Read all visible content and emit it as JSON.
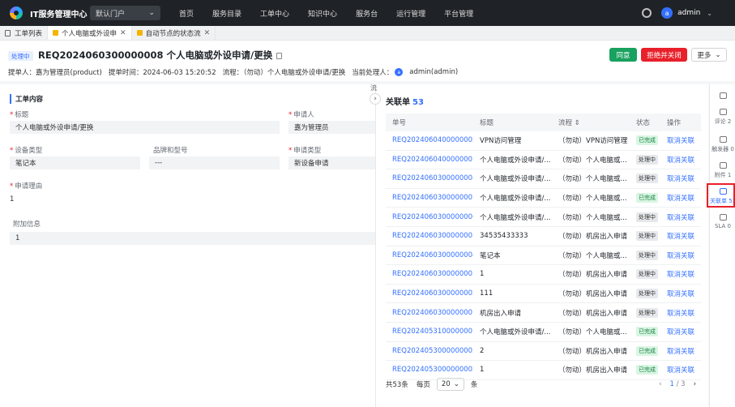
{
  "nav": {
    "brand": "IT服务管理中心",
    "portal": "默认门户",
    "menu": [
      "首页",
      "服务目录",
      "工单中心",
      "知识中心",
      "服务台",
      "运行管理",
      "平台管理"
    ],
    "user_initial": "a",
    "user": "admin"
  },
  "tabs": [
    {
      "label": "工单列表"
    },
    {
      "label": "个人电脑或外设申"
    },
    {
      "label": "自动节点的状态流"
    }
  ],
  "header": {
    "status": "处理中",
    "title": "REQ2024060300000008 个人电脑或外设申请/更换",
    "submitter": "提单人：嘉为管理员(product)",
    "submit_time": "提单时间：2024-06-03 15:20:52",
    "flow": "流程：（勿动）个人电脑或外设申请/更换",
    "handler_label": "当前处理人：",
    "handler": "admin(admin)",
    "approve": "同意",
    "reject": "拒绝并关闭",
    "more": "更多"
  },
  "form": {
    "section": "工单内容",
    "title_label": "标题",
    "title_value": "个人电脑或外设申请/更换",
    "applicant_label": "申请人",
    "applicant_value": "嘉为管理员",
    "device_type_label": "设备类型",
    "device_type_value": "笔记本",
    "brand_label": "品牌和型号",
    "brand_value": "---",
    "apply_type_label": "申请类型",
    "apply_type_value": "新设备申请",
    "reason_label": "申请理由",
    "reason_value": "1",
    "extra_label": "附加信息",
    "extra_value": "1",
    "flow_cut": "流"
  },
  "related": {
    "title": "关联单",
    "count": "53",
    "columns": [
      "单号",
      "标题",
      "流程 ⇕",
      "状态",
      "操作"
    ],
    "rows": [
      {
        "id": "REQ2024060400000002",
        "title": "VPN访问管理",
        "flow": "（勿动）VPN访问管理",
        "status": "已完成",
        "s": "done",
        "op": "取消关联"
      },
      {
        "id": "REQ2024060400000001",
        "title": "个人电脑或外设申请/...",
        "flow": "（勿动）个人电脑或...",
        "status": "处理中",
        "s": "proc",
        "op": "取消关联"
      },
      {
        "id": "REQ2024060300000008",
        "title": "个人电脑或外设申请/...",
        "flow": "（勿动）个人电脑或...",
        "status": "处理中",
        "s": "proc",
        "op": "取消关联"
      },
      {
        "id": "REQ2024060300000007",
        "title": "个人电脑或外设申请/...",
        "flow": "（勿动）个人电脑或...",
        "status": "已完成",
        "s": "done",
        "op": "取消关联"
      },
      {
        "id": "REQ2024060300000006",
        "title": "个人电脑或外设申请/...",
        "flow": "（勿动）个人电脑或...",
        "status": "处理中",
        "s": "proc",
        "op": "取消关联"
      },
      {
        "id": "REQ2024060300000005",
        "title": "34535433333",
        "flow": "（勿动）机房出入申请",
        "status": "处理中",
        "s": "proc",
        "op": "取消关联"
      },
      {
        "id": "REQ2024060300000004",
        "title": "笔记本",
        "flow": "（勿动）个人电脑或...",
        "status": "处理中",
        "s": "proc",
        "op": "取消关联"
      },
      {
        "id": "REQ2024060300000003",
        "title": "1",
        "flow": "（勿动）机房出入申请",
        "status": "处理中",
        "s": "proc",
        "op": "取消关联"
      },
      {
        "id": "REQ2024060300000002",
        "title": "111",
        "flow": "（勿动）机房出入申请",
        "status": "处理中",
        "s": "proc",
        "op": "取消关联"
      },
      {
        "id": "REQ2024060300000001",
        "title": "机房出入申请",
        "flow": "（勿动）机房出入申请",
        "status": "处理中",
        "s": "proc",
        "op": "取消关联"
      },
      {
        "id": "REQ2024053100000001",
        "title": "个人电脑或外设申请/...",
        "flow": "（勿动）个人电脑或...",
        "status": "已完成",
        "s": "done",
        "op": "取消关联"
      },
      {
        "id": "REQ2024053000000003",
        "title": "2",
        "flow": "（勿动）机房出入申请",
        "status": "已完成",
        "s": "done",
        "op": "取消关联"
      },
      {
        "id": "REQ2024053000000002",
        "title": "1",
        "flow": "（勿动）机房出入申请",
        "status": "已完成",
        "s": "done",
        "op": "取消关联"
      }
    ],
    "total": "共53条",
    "per_page_label": "每页",
    "per_page": "20",
    "per_page_unit": "条",
    "page": "1",
    "pages": "3"
  },
  "rail": [
    {
      "label": "",
      "icon": "list-icon"
    },
    {
      "label": "评论 2",
      "icon": "comment-icon"
    },
    {
      "label": "触发器 0",
      "icon": "trigger-icon"
    },
    {
      "label": "附件 1",
      "icon": "attachment-icon"
    },
    {
      "label": "关联单 53",
      "icon": "link-icon"
    },
    {
      "label": "SLA 0",
      "icon": "sla-icon"
    }
  ]
}
